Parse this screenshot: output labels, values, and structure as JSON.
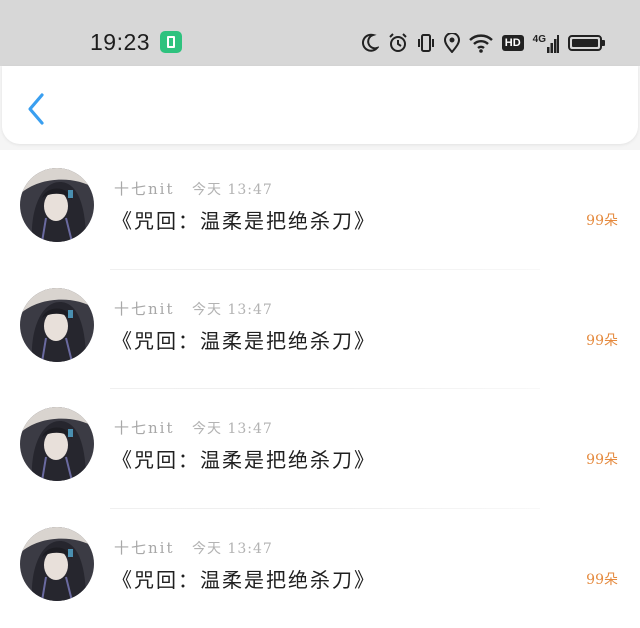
{
  "status_bar": {
    "time": "19:23",
    "hd_label": "HD",
    "network_label": "4G"
  },
  "nav": {
    "back_icon": "chevron-left-icon",
    "accent_color": "#3a9ff0"
  },
  "gifts": [
    {
      "username": "十七nit",
      "time": "今天 13:47",
      "title": "《咒回：温柔是把绝杀刀》",
      "count": "99朵"
    },
    {
      "username": "十七nit",
      "time": "今天 13:47",
      "title": "《咒回：温柔是把绝杀刀》",
      "count": "99朵"
    },
    {
      "username": "十七nit",
      "time": "今天 13:47",
      "title": "《咒回：温柔是把绝杀刀》",
      "count": "99朵"
    },
    {
      "username": "十七nit",
      "time": "今天 13:47",
      "title": "《咒回：温柔是把绝杀刀》",
      "count": "99朵"
    }
  ]
}
